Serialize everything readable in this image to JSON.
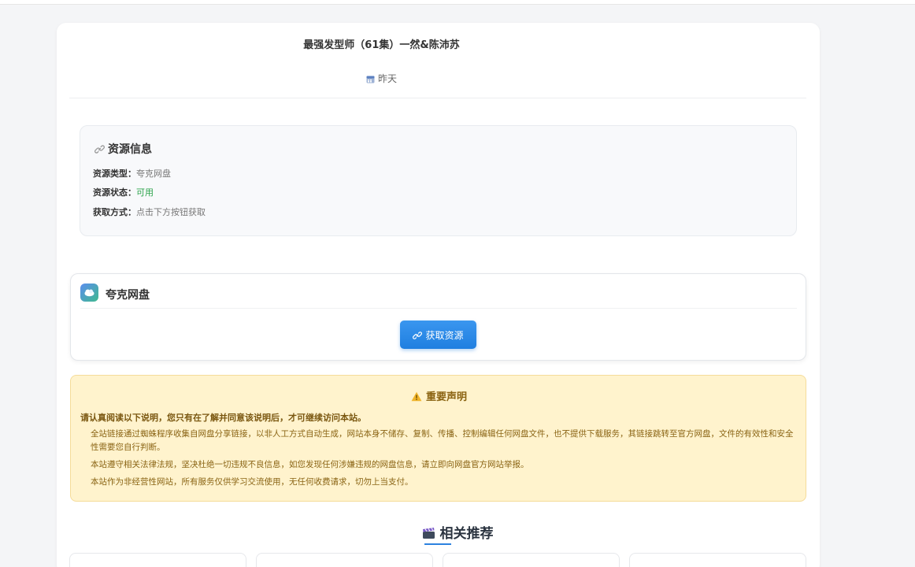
{
  "page": {
    "title": "最强发型师（61集）一然&陈沛苏",
    "date": "昨天"
  },
  "resource_info": {
    "heading": "资源信息",
    "rows": [
      {
        "key": "资源类型：",
        "value": "夸克网盘",
        "status": "normal"
      },
      {
        "key": "资源状态：",
        "value": "可用",
        "status": "ok"
      },
      {
        "key": "获取方式：",
        "value": "点击下方按钮获取",
        "status": "normal"
      }
    ]
  },
  "drive": {
    "name": "夸克网盘",
    "button_label": "获取资源"
  },
  "notice": {
    "heading": "重要声明",
    "lead": "请认真阅读以下说明，您只有在了解并同意该说明后，才可继续访问本站。",
    "paragraphs": [
      "全站链接通过蜘蛛程序收集自网盘分享链接，以非人工方式自动生成，网站本身不储存、复制、传播、控制编辑任何网盘文件，也不提供下载服务，其链接跳转至官方网盘，文件的有效性和安全性需要您自行判断。",
      "本站遵守相关法律法规，坚决杜绝一切违规不良信息，如您发现任何涉嫌违规的网盘信息，请立即向网盘官方网站举报。",
      "本站作为非经营性网站，所有服务仅供学习交流使用，无任何收费请求，切勿上当支付。"
    ]
  },
  "recommend": {
    "heading": "相关推荐",
    "items": [
      "",
      "",
      "",
      ""
    ]
  },
  "colors": {
    "accent": "#1f7fe0",
    "ok": "#2aa34a",
    "notice_bg": "#fff3cd",
    "notice_text": "#8a6414"
  }
}
